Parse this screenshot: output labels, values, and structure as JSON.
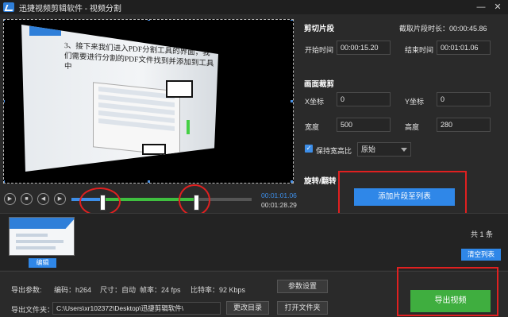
{
  "window": {
    "title": "迅捷视频剪辑软件 - 视频分割",
    "minimize_glyph": "—",
    "close_glyph": "✕"
  },
  "player": {
    "current_time": "00:01:01.06",
    "total_time": "00:01:28.29",
    "controls": [
      "play-icon",
      "stop-icon",
      "prev-frame-icon",
      "next-frame-icon"
    ],
    "slide_text": "3、接下来我们进入PDF分割工具的界面，我们需要进行分割的PDF文件找到并添加到工具中"
  },
  "clip": {
    "section_title": "剪切片段",
    "duration_label": "截取片段时长：00:00:45.86",
    "start_label": "开始时间",
    "start_value": "00:00:15.20",
    "end_label": "结束时间",
    "end_value": "00:01:01.06"
  },
  "crop": {
    "section_title": "画面裁剪",
    "x_label": "X坐标",
    "x_value": "0",
    "y_label": "Y坐标",
    "y_value": "0",
    "w_label": "宽度",
    "w_value": "500",
    "h_label": "高度",
    "h_value": "280",
    "keep_ratio_label": "保持宽高比",
    "ratio_select": "原始"
  },
  "rotate": {
    "section_title": "旋转/翻转"
  },
  "actions": {
    "add_segment": "添加片段至列表",
    "clip_count": "共 1 条",
    "clear_list": "清空列表",
    "edit": "编辑",
    "export": "导出视频"
  },
  "export": {
    "params_label": "导出参数:",
    "codec": "编码：h264",
    "size": "尺寸：自动",
    "fps": "帧率：24 fps",
    "bitrate": "比特率：92 Kbps",
    "settings_button": "参数设置",
    "folder_label": "导出文件夹：",
    "folder_path": "C:\\Users\\xr102372\\Desktop\\迅捷剪辑软件\\",
    "change_dir_button": "更改目录",
    "open_folder_button": "打开文件夹"
  },
  "colors": {
    "accent_blue": "#2f87e8",
    "accent_green": "#3fae3f",
    "annotation_red": "#e02020"
  }
}
